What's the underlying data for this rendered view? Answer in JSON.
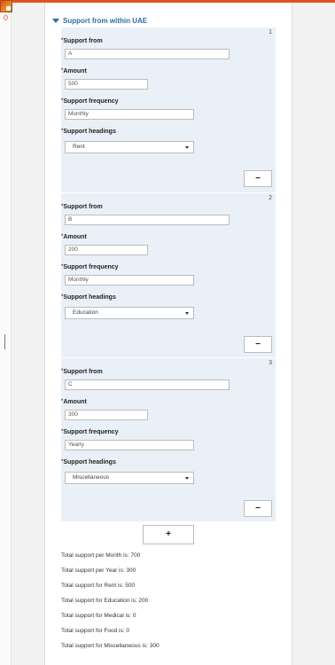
{
  "app": {
    "badge_count": "0"
  },
  "section": {
    "title": "Support from within UAE"
  },
  "labels": {
    "support_from": "Support from",
    "amount": "Amount",
    "support_frequency": "Support frequency",
    "support_headings": "Support headings",
    "required_mark": "*",
    "remove_button": "−",
    "add_button": "+"
  },
  "entries": [
    {
      "number": "1",
      "support_from": "A",
      "amount": "500",
      "frequency": "Monthly",
      "heading": "Rent"
    },
    {
      "number": "2",
      "support_from": "B",
      "amount": "200",
      "frequency": "Monthly",
      "heading": "Education"
    },
    {
      "number": "3",
      "support_from": "C",
      "amount": "300",
      "frequency": "Yearly",
      "heading": "Miscellaneous"
    }
  ],
  "totals": [
    "Total support per Month is: 700",
    "Total support per Year is: 300",
    "Total support for Rent is: 500",
    "Total support for Education is: 200",
    "Total support for Medical is: 0",
    "Total support for Food is: 0",
    "Total support for Miscellaneous is: 300"
  ]
}
